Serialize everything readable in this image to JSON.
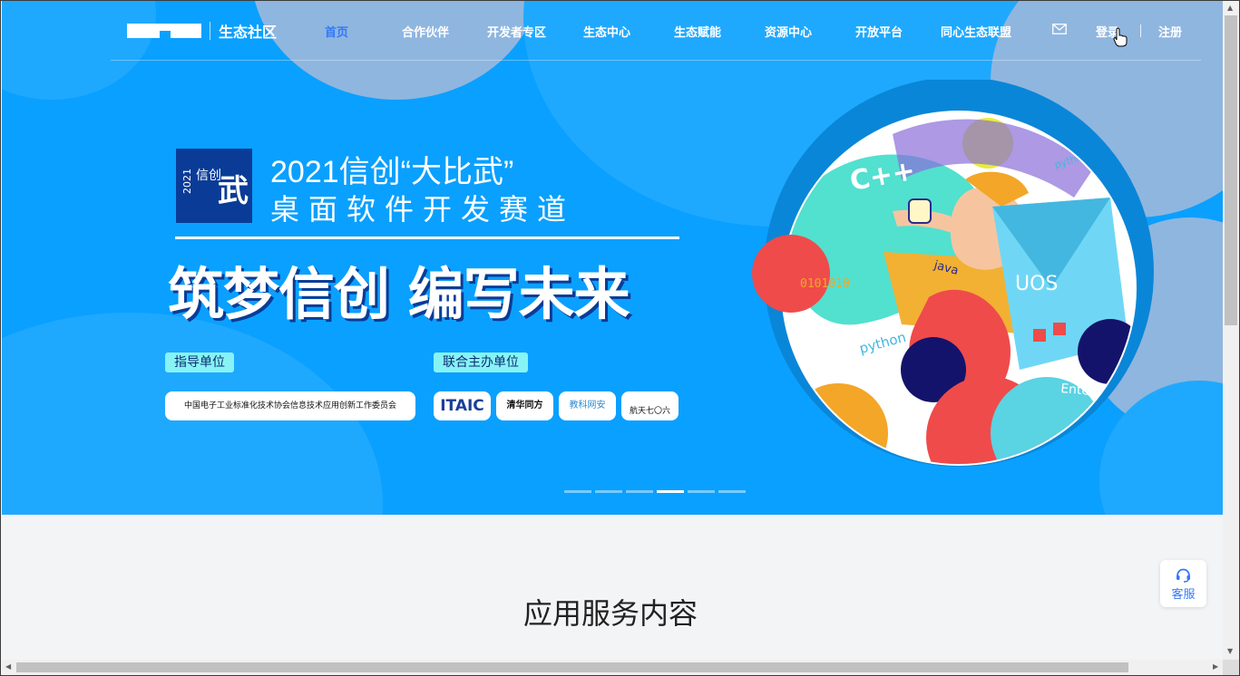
{
  "header": {
    "brand": "生态社区",
    "nav": [
      {
        "label": "首页",
        "active": true
      },
      {
        "label": "合作伙伴"
      },
      {
        "label": "开发者专区"
      },
      {
        "label": "生态中心"
      },
      {
        "label": "生态赋能"
      },
      {
        "label": "资源中心"
      },
      {
        "label": "开放平台"
      },
      {
        "label": "同心生态联盟"
      }
    ],
    "mail_icon": "mail-icon",
    "login": "登录",
    "register": "注册"
  },
  "banner": {
    "badge_text": "2021信创",
    "badge_sub": "武",
    "title_line1": "2021信创“大比武”",
    "title_line2": "桌面软件开发赛道",
    "slogan": "筑梦信创 编写未来",
    "guide_label": "指导单位",
    "guide_unit": "中国电子工业标准化技术协会信息技术应用创新工作委员会",
    "host_label": "联合主办单位",
    "hosts": [
      "ITAIC",
      "清华同方",
      "教科网安",
      "航天七〇六"
    ],
    "art_words": [
      "C++",
      "python",
      "java",
      "UOS",
      "0101010",
      "python",
      "Enter"
    ],
    "slides": 6,
    "active_slide": 4
  },
  "main": {
    "section_title": "应用服务内容"
  },
  "service": {
    "label": "客服",
    "icon": "headset-icon"
  },
  "colors": {
    "hero_bg": "#0aa0ff",
    "nav_active": "#3478f6",
    "badge_bg": "#0a3c97",
    "tag_bg": "#87f3f5"
  }
}
